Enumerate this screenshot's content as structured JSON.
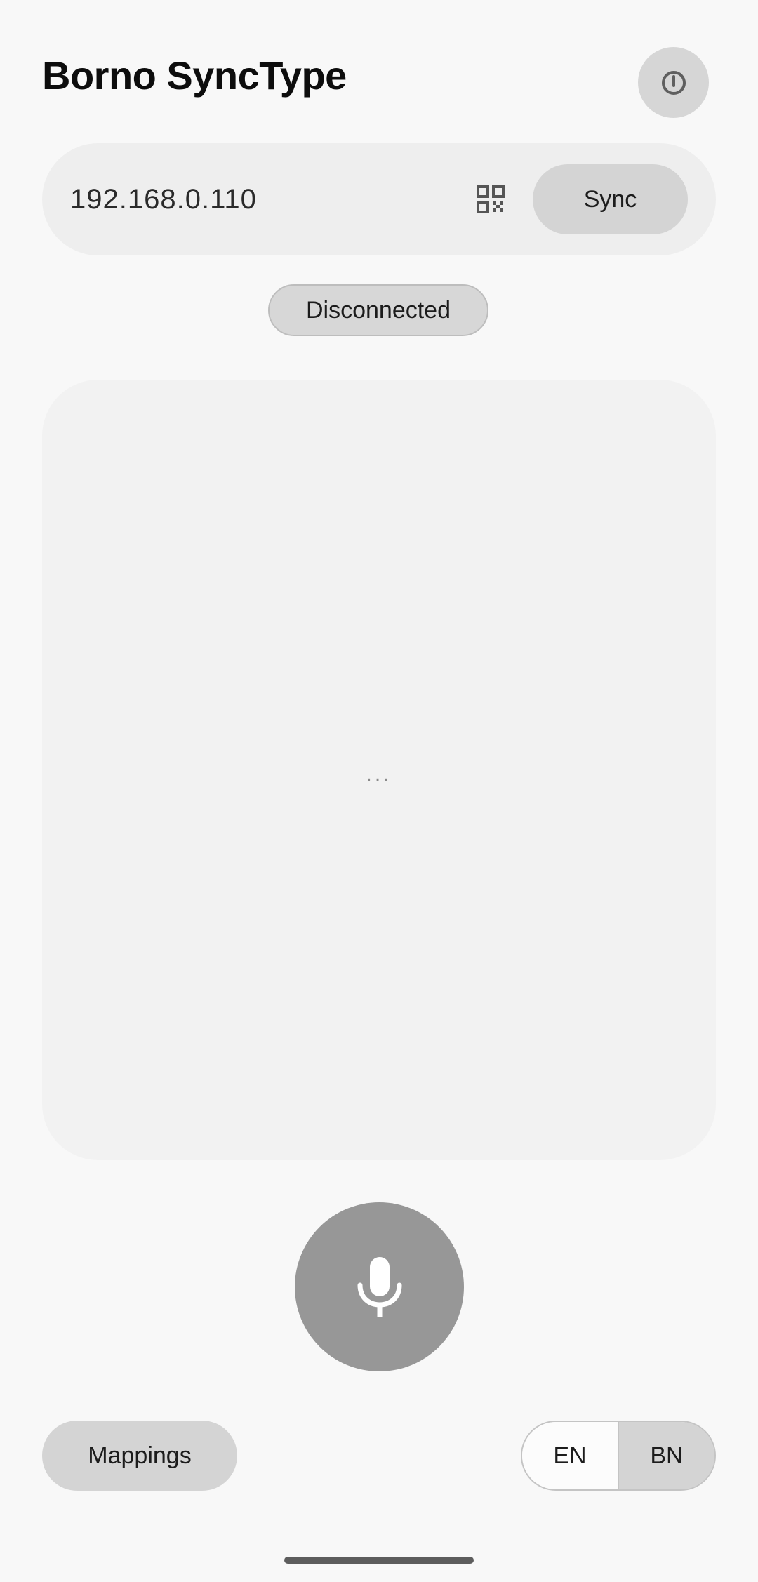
{
  "app": {
    "title": "Borno SyncType"
  },
  "header": {
    "power_icon": "power-icon"
  },
  "connection": {
    "ip_value": "192.168.0.110",
    "qr_icon": "qr-code-icon",
    "sync_label": "Sync",
    "status": "Disconnected"
  },
  "transcript": {
    "placeholder": "..."
  },
  "mic": {
    "icon": "microphone-icon"
  },
  "footer": {
    "mappings_label": "Mappings",
    "languages": [
      {
        "label": "EN",
        "selected": false
      },
      {
        "label": "BN",
        "selected": true
      }
    ]
  },
  "colors": {
    "background": "#f8f8f8",
    "surface": "#eeeeee",
    "panel": "#f2f2f2",
    "button": "#d4d4d4",
    "mic": "#979797"
  }
}
